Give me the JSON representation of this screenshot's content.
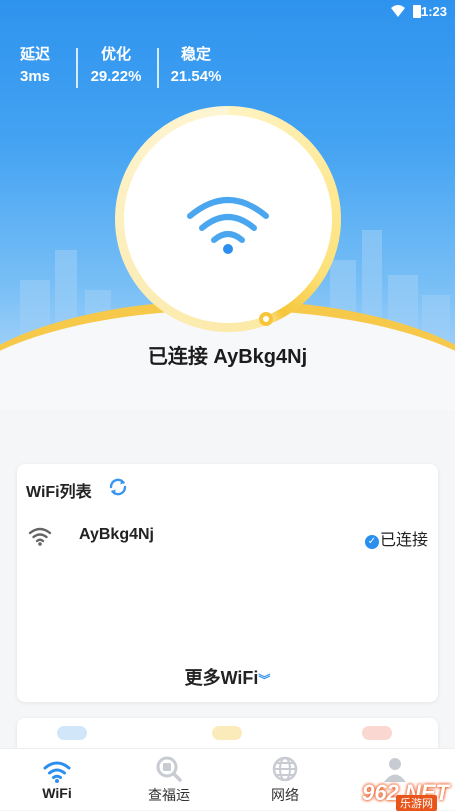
{
  "status_bar": {
    "time": "11:23"
  },
  "stats": [
    {
      "label": "延迟",
      "value": "3ms"
    },
    {
      "label": "优化",
      "value": "29.22%"
    },
    {
      "label": "稳定",
      "value": "21.54%"
    }
  ],
  "connection": {
    "text": "已连接  AyBkg4Nj"
  },
  "wifi_list": {
    "title": "WiFi列表",
    "networks": [
      {
        "name": "AyBkg4Nj",
        "status": "已连接"
      }
    ],
    "more_label": "更多WiFi"
  },
  "tabs": [
    {
      "label": "WiFi"
    },
    {
      "label": "查福运"
    },
    {
      "label": "网络"
    }
  ],
  "watermark": {
    "text": "962.NET",
    "sub": "乐游网"
  },
  "colors": {
    "accent": "#2b8ff0",
    "ring": "#f6c53a",
    "hero_top": "#2e93ee"
  }
}
